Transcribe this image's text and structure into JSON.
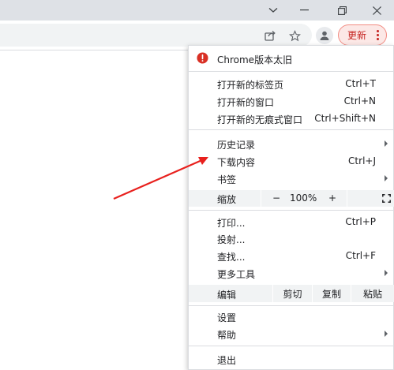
{
  "window_controls": {
    "chevron": "chevron-down-icon",
    "minimize": "minimize-icon",
    "restore": "restore-icon",
    "close": "close-icon"
  },
  "toolbar": {
    "share_icon": "share-icon",
    "star_icon": "star-icon",
    "profile_icon": "profile-icon",
    "update_label": "更新",
    "menu_icon": "more-vert-icon",
    "accent_color": "#c5221f"
  },
  "menu": {
    "header": {
      "label": "Chrome版本太旧",
      "icon": "chrome-warning-icon"
    },
    "group1": [
      {
        "label": "打开新的标签页",
        "shortcut": "Ctrl+T"
      },
      {
        "label": "打开新的窗口",
        "shortcut": "Ctrl+N"
      },
      {
        "label": "打开新的无痕式窗口",
        "shortcut": "Ctrl+Shift+N"
      }
    ],
    "group2": [
      {
        "label": "历史记录",
        "shortcut": ""
      },
      {
        "label": "下载内容",
        "shortcut": "Ctrl+J"
      },
      {
        "label": "书签",
        "shortcut": ""
      }
    ],
    "zoom": {
      "label": "缩放",
      "minus": "−",
      "value": "100%",
      "plus": "+",
      "fullscreen_icon": "fullscreen-icon"
    },
    "group3": [
      {
        "label": "打印...",
        "shortcut": "Ctrl+P"
      },
      {
        "label": "投射...",
        "shortcut": ""
      },
      {
        "label": "查找...",
        "shortcut": "Ctrl+F"
      },
      {
        "label": "更多工具",
        "shortcut": ""
      }
    ],
    "edit": {
      "label": "编辑",
      "cut": "剪切",
      "copy": "复制",
      "paste": "粘贴"
    },
    "group4": [
      {
        "label": "设置",
        "shortcut": ""
      },
      {
        "label": "帮助",
        "shortcut": ""
      }
    ],
    "exit": {
      "label": "退出"
    }
  },
  "annotation": {
    "arrow_color": "#e8201d"
  }
}
